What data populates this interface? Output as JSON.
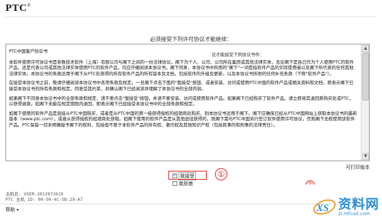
{
  "header": {
    "brand": "PTC",
    "trademark": "®"
  },
  "prompt": "必须接受下列许可协议才能继续：",
  "document": {
    "title": "PTC中国客户协议书",
    "inline_overlay": "论才能接受下例协议书件：",
    "paragraphs": [
      "本软件使用许可协议书是参数技术软件（上海）有限公司与阁下之间的一份法律协议。阁下为个人、公司、公司所在集团或其他法律实体，无论阁下是自己作为个人使用PTC的软件产品，还是代表公司或其他法律实体使用PTC的软件产品，均应仔细阅读本协议书。阁下同意，本协议书中所用的\"阁下\"一词是指软件产品的实际使用者以及阁下所代表的任何其他法律实体。本协议书的条款适用于阁下从PTC处获得的所有软件产品的所有版本及文档，包括软件的升级及更新，以及本协议书所附的任何补充条款（下称\"软件产品\"）。",
      "在接受本协议书之前，敬请仔细阅读本协议书中各项条款及规定。一旦阁下点击下面的\"我接受\"按钮、或者安装、访问或使用PTC中国的软件产品或相关资料和文档，即表示阁下已接受本协议书的所有条款和规定，同意受其约束，并确认阁下已经阅读并理解了本协议书的全部内容。",
      "如果阁下不同意本协议书中的全部条款和规定，请不要点击\"我接受\"按钮，并请不要安装、访问或使用软件产品。如果阁下已经购买了软件产品，请立即将其退回原购买处或PTC，以获得退款。如阁下未能在规定期限内退回，即表示阁下已经接受本协议书中的全部条款和规定。",
      "如阁下使用的软件产品是直接从PTC中国购买，或者是从PTC中国的第一级获得授权的经销商处购买，则本协议书适用于阁下。阁下应确保已经从PTC中国网站上获取本协议书的最新版本（www.ptc.com），或者从获得授权的经销商处获取。如阁下使用的软件产品是从其他途径获得的，则阁下需与PTC中国另行签订软件使用许可协议，否则阁下无权使用该软件产品。PTC保留一切未明确授予阁下的权利，包括但不限于本软件产品的所有权、著作权及其他知识产权（包括民事的和刑事的法律责任）。"
    ]
  },
  "print_link": "可打印版本",
  "radios": {
    "accept": "我接受",
    "reject": "我拒绝",
    "selected": "accept"
  },
  "annotations": {
    "step1": "①",
    "step2": "②"
  },
  "host": {
    "name_label": "主机名:",
    "name_value": "USER-2012072619",
    "id_label": "PTC 主机 ID:",
    "id_value": "00-50-4C-5B-29-A7"
  },
  "footer": {
    "help": "帮助"
  },
  "watermark": {
    "text": "资料网",
    "url": "zl.mfcad.com"
  },
  "colors": {
    "annotation_red": "#e02020",
    "watermark_blue": "#2a8fd6"
  }
}
